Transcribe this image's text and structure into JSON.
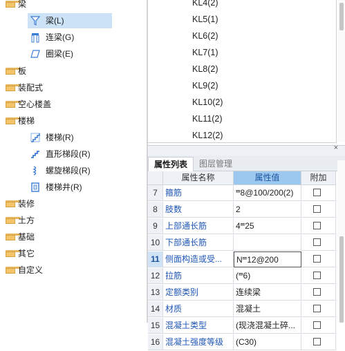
{
  "tree": {
    "root_label": "梁",
    "beam_children": [
      {
        "label": "梁(L)",
        "icon": "beam-filter-icon"
      },
      {
        "label": "连梁(G)",
        "icon": "coupling-beam-icon"
      },
      {
        "label": "圈梁(E)",
        "icon": "ring-beam-icon"
      }
    ],
    "folders": [
      "板",
      "装配式",
      "空心楼盖",
      "楼梯"
    ],
    "stair_children": [
      {
        "label": "楼梯(R)",
        "icon": "stair-icon"
      },
      {
        "label": "直形梯段(R)",
        "icon": "straight-flight-icon"
      },
      {
        "label": "螺旋梯段(R)",
        "icon": "spiral-flight-icon"
      },
      {
        "label": "楼梯井(R)",
        "icon": "stair-well-icon"
      }
    ],
    "folders2": [
      "装修",
      "土方",
      "基础",
      "其它",
      "自定义"
    ]
  },
  "kl_items": [
    "KL4(2)",
    "KL5(1)",
    "KL6(2)",
    "KL7(1)",
    "KL8(2)",
    "KL9(2)",
    "KL10(2)",
    "KL11(2)",
    "KL12(2)"
  ],
  "panel": {
    "close": "×",
    "tabs": [
      "属性列表",
      "图层管理"
    ],
    "headers": [
      "属性名称",
      "属性值",
      "附加"
    ]
  },
  "rows": [
    {
      "num": "7",
      "name": "箍筋",
      "value": "ⱎ8@100/200(2)"
    },
    {
      "num": "8",
      "name": "肢数",
      "value": "2"
    },
    {
      "num": "9",
      "name": "上部通长筋",
      "value": "4ⱎ25"
    },
    {
      "num": "10",
      "name": "下部通长筋",
      "value": ""
    },
    {
      "num": "11",
      "name": "侧面构造或受...",
      "value": "Nⱎ12@200"
    },
    {
      "num": "12",
      "name": "拉筋",
      "value": "(ⱎ6)"
    },
    {
      "num": "13",
      "name": "定额类别",
      "value": "连续梁"
    },
    {
      "num": "14",
      "name": "材质",
      "value": "混凝土"
    },
    {
      "num": "15",
      "name": "混凝土类型",
      "value": "(现浇混凝土碎..."
    },
    {
      "num": "16",
      "name": "混凝土强度等级",
      "value": "(C30)"
    }
  ],
  "colors": {
    "selection": "#cce3f7",
    "header_highlight": "#9cc8f0",
    "name_text": "#1f57b8"
  }
}
